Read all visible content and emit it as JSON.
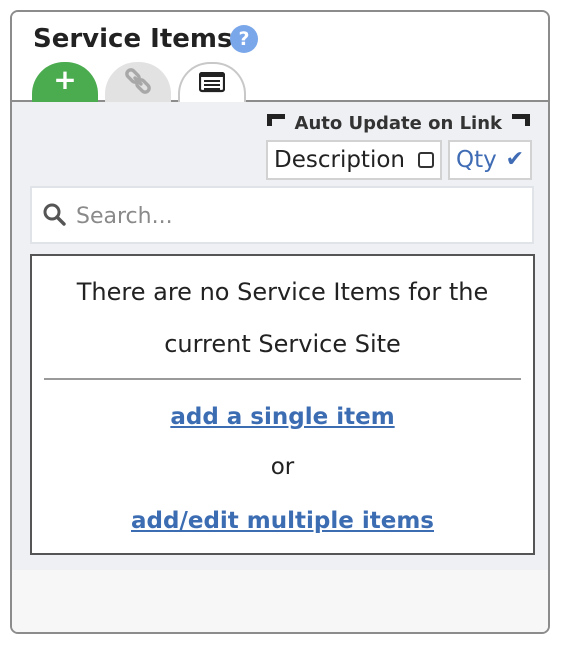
{
  "panel": {
    "title": "Service Items",
    "help_glyph": "?",
    "tabs": [
      {
        "name": "add",
        "icon": "plus-icon",
        "glyph": "+",
        "color": "#4bab4f"
      },
      {
        "name": "link",
        "icon": "link-icon",
        "color": "#e2e2e2"
      },
      {
        "name": "list",
        "icon": "list-icon",
        "color": "#ffffff"
      }
    ]
  },
  "auto_update": {
    "label": "Auto Update on Link",
    "description_label": "Description",
    "description_checked": false,
    "qty_label": "Qty",
    "qty_checked": true,
    "qty_check_glyph": "✔"
  },
  "search": {
    "placeholder": "Search...",
    "value": ""
  },
  "empty_state": {
    "message": "There are no Service Items for the current Service Site",
    "add_single_link": "add a single item",
    "or_text": "or",
    "add_multiple_link": "add/edit multiple items"
  },
  "colors": {
    "accent_green": "#4bab4f",
    "link_blue": "#3c6db3",
    "help_blue": "#7aa6ea"
  }
}
